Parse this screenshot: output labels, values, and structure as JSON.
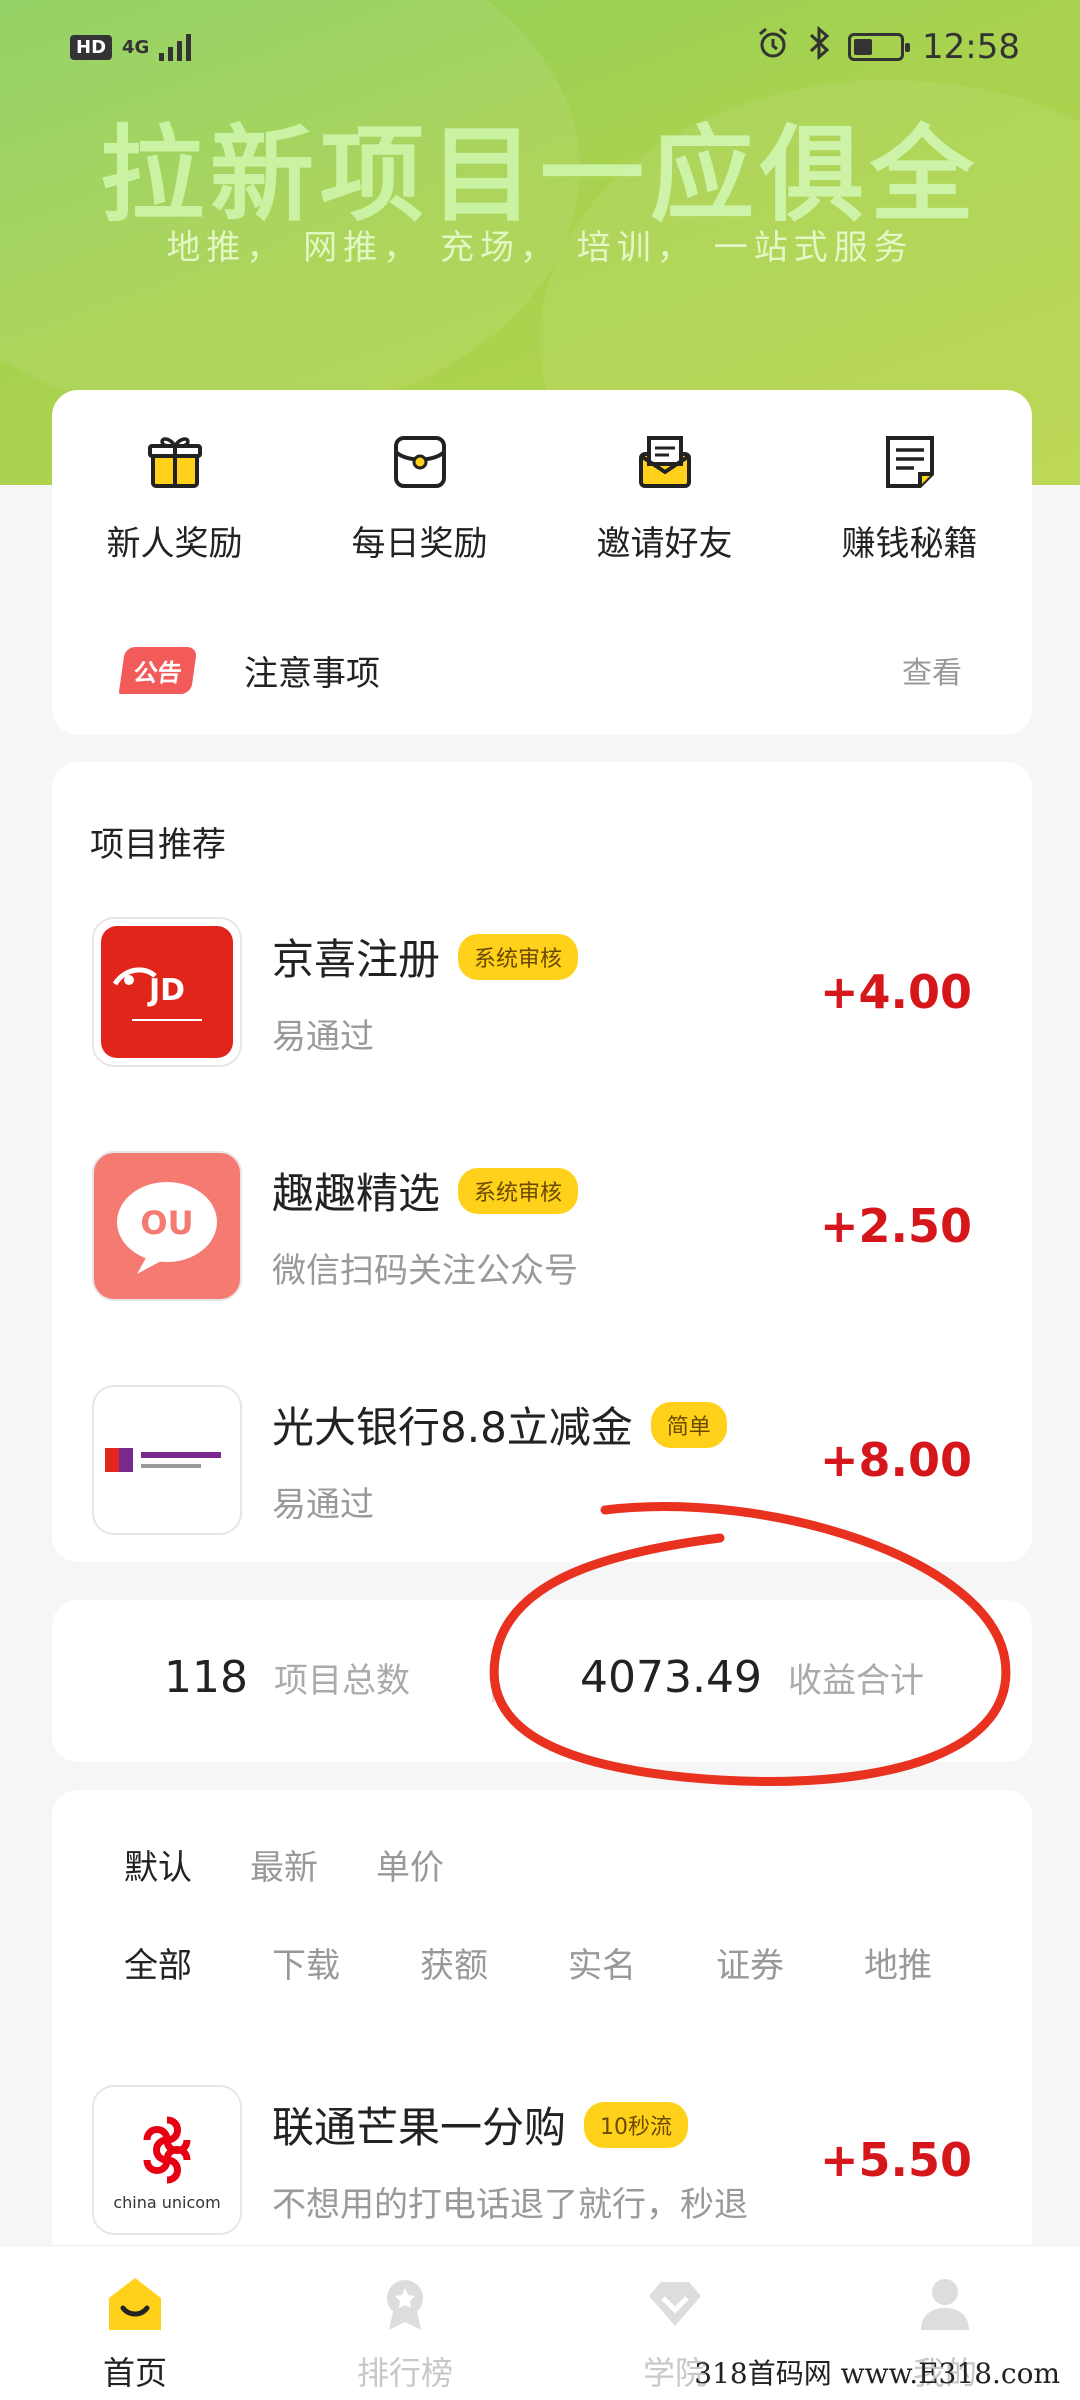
{
  "status_bar": {
    "network": "HD",
    "signal": "4G",
    "time": "12:58"
  },
  "banner": {
    "headline": "拉新项目一应俱全",
    "subtitle": "地推，  网推，  充场，  培训，  一站式服务"
  },
  "quick_links": [
    {
      "label": "新人奖励",
      "icon": "gift-icon"
    },
    {
      "label": "每日奖励",
      "icon": "red-envelope-icon"
    },
    {
      "label": "邀请好友",
      "icon": "envelope-icon"
    },
    {
      "label": "赚钱秘籍",
      "icon": "document-icon"
    }
  ],
  "notice": {
    "tag": "公告",
    "title": "注意事项",
    "action": "查看"
  },
  "recommend": {
    "title": "项目推荐",
    "items": [
      {
        "name": "京喜注册",
        "badge": "系统审核",
        "desc": "易通过",
        "amount": "+4.00",
        "icon": "jd-logo-icon"
      },
      {
        "name": "趣趣精选",
        "badge": "系统审核",
        "desc": "微信扫码关注公众号",
        "amount": "+2.50",
        "icon": "ququ-logo-icon"
      },
      {
        "name": "光大银行8.8立减金",
        "badge": "简单",
        "desc": "易通过",
        "amount": "+8.00",
        "icon": "ceb-bank-logo-icon"
      }
    ]
  },
  "stats": {
    "total_projects": "118",
    "total_projects_label": "项目总数",
    "income_total": "4073.49",
    "income_total_label": "收益合计"
  },
  "filters": {
    "sort": [
      "默认",
      "最新",
      "单价"
    ],
    "categories": [
      "全部",
      "下载",
      "获额",
      "实名",
      "证券",
      "地推"
    ]
  },
  "list": [
    {
      "name": "联通芒果一分购",
      "badge": "10秒流",
      "desc": "不想用的打电话退了就行，秒退",
      "amount": "+5.50",
      "icon": "china-unicom-logo-icon"
    }
  ],
  "tabbar": [
    {
      "label": "首页",
      "active": true
    },
    {
      "label": "排行榜",
      "active": false
    },
    {
      "label": "学院",
      "active": false
    },
    {
      "label": "我的",
      "active": false
    }
  ],
  "watermark": "318首码网  www.E318.com",
  "colors": {
    "accent_red": "#d5171b",
    "badge_yellow": "#ffd11a",
    "banner_green": "#a8d24f"
  }
}
